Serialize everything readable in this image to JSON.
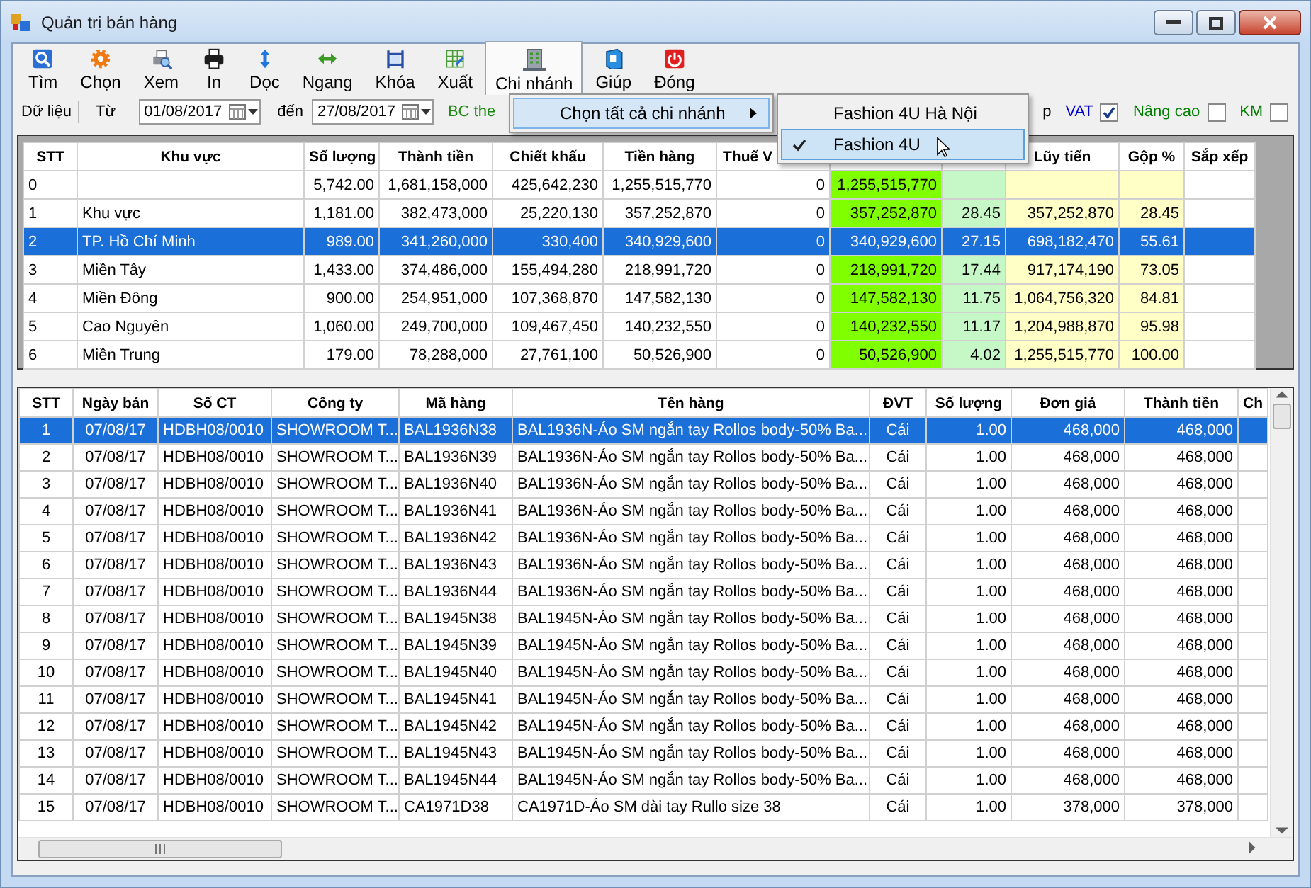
{
  "window": {
    "title": "Quản trị bán hàng"
  },
  "toolbar": [
    {
      "label": "Tìm",
      "selected": false
    },
    {
      "label": "Chọn",
      "selected": false
    },
    {
      "label": "Xem",
      "selected": false
    },
    {
      "label": "In",
      "selected": false
    },
    {
      "label": "Dọc",
      "selected": false
    },
    {
      "label": "Ngang",
      "selected": false
    },
    {
      "label": "Khóa",
      "selected": false
    },
    {
      "label": "Xuất",
      "selected": false
    },
    {
      "label": "Chi nhánh",
      "selected": true
    },
    {
      "label": "Giúp",
      "selected": false
    },
    {
      "label": "Đóng",
      "selected": false
    }
  ],
  "filter": {
    "data_label": "Dữ liệu",
    "from_label": "Từ",
    "from_date": "01/08/2017",
    "to_label": "đến",
    "to_date": "27/08/2017",
    "report_label": "BC the",
    "cut_button": "p",
    "options": [
      {
        "label": "VAT",
        "checked": true,
        "color": "#0000cc"
      },
      {
        "label": "Nâng cao",
        "checked": false,
        "color": "#008000"
      },
      {
        "label": "KM",
        "checked": false,
        "color": "#008000"
      }
    ]
  },
  "branch_menu": {
    "items": [
      {
        "label": "Chọn tất cả chi nhánh",
        "has_submenu": true
      }
    ],
    "submenu": [
      {
        "label": "Fashion 4U Hà Nội",
        "checked": false,
        "selected": false
      },
      {
        "label": "Fashion 4U",
        "checked": true,
        "selected": true
      }
    ]
  },
  "region_table": {
    "columns": [
      {
        "label": "STT"
      },
      {
        "label": "Khu vực"
      },
      {
        "label": "Số lượng"
      },
      {
        "label": "Thành tiền"
      },
      {
        "label": "Chiết khấu"
      },
      {
        "label": "Tiền hàng"
      },
      {
        "label": "Thuế V"
      },
      {
        "color": "#80ff00"
      },
      {
        "color": "#c6f7c6"
      },
      {
        "label": "Lũy tiến",
        "color": "#ffffc6"
      },
      {
        "label": "Gộp %",
        "color": "#ffffc6"
      },
      {
        "label": "Sắp xếp"
      }
    ],
    "rows": [
      {
        "selected": false,
        "cells": [
          "0",
          null,
          "5,742.00",
          "1,681,158,000",
          "425,642,230",
          "1,255,515,770",
          "0",
          "1,255,515,770",
          null,
          null,
          null,
          null
        ]
      },
      {
        "selected": false,
        "cells": [
          "1",
          "Khu vực",
          "1,181.00",
          "382,473,000",
          "25,220,130",
          "357,252,870",
          "0",
          "357,252,870",
          "28.45",
          "357,252,870",
          "28.45",
          null
        ]
      },
      {
        "selected": true,
        "cells": [
          "2",
          "TP. Hồ Chí Minh",
          "989.00",
          "341,260,000",
          "330,400",
          "340,929,600",
          "0",
          "340,929,600",
          "27.15",
          "698,182,470",
          "55.61",
          null
        ]
      },
      {
        "selected": false,
        "cells": [
          "3",
          "Miền Tây",
          "1,433.00",
          "374,486,000",
          "155,494,280",
          "218,991,720",
          "0",
          "218,991,720",
          "17.44",
          "917,174,190",
          "73.05",
          null
        ]
      },
      {
        "selected": false,
        "cells": [
          "4",
          "Miền Đông",
          "900.00",
          "254,951,000",
          "107,368,870",
          "147,582,130",
          "0",
          "147,582,130",
          "11.75",
          "1,064,756,320",
          "84.81",
          null
        ]
      },
      {
        "selected": false,
        "cells": [
          "5",
          "Cao Nguyên",
          "1,060.00",
          "249,700,000",
          "109,467,450",
          "140,232,550",
          "0",
          "140,232,550",
          "11.17",
          "1,204,988,870",
          "95.98",
          null
        ]
      },
      {
        "selected": false,
        "cells": [
          "6",
          "Miền Trung",
          "179.00",
          "78,288,000",
          "27,761,100",
          "50,526,900",
          "0",
          "50,526,900",
          "4.02",
          "1,255,515,770",
          "100.00",
          null
        ]
      }
    ]
  },
  "sales_table": {
    "columns": [
      "STT",
      "Ngày bán",
      "Số CT",
      "Công ty",
      "Mã hàng",
      "Tên hàng",
      "ĐVT",
      "Số lượng",
      "Đơn giá",
      "Thành tiền",
      "Ch"
    ],
    "rows": [
      {
        "selected": true,
        "cells": [
          "1",
          "07/08/17",
          "HDBH08/0010",
          "SHOWROOM T...",
          "BAL1936N38",
          "BAL1936N-Áo SM ngắn tay Rollos body-50% Ba...",
          "Cái",
          "1.00",
          "468,000",
          "468,000"
        ]
      },
      {
        "selected": false,
        "cells": [
          "2",
          "07/08/17",
          "HDBH08/0010",
          "SHOWROOM T...",
          "BAL1936N39",
          "BAL1936N-Áo SM ngắn tay Rollos body-50% Ba...",
          "Cái",
          "1.00",
          "468,000",
          "468,000"
        ]
      },
      {
        "selected": false,
        "cells": [
          "3",
          "07/08/17",
          "HDBH08/0010",
          "SHOWROOM T...",
          "BAL1936N40",
          "BAL1936N-Áo SM ngắn tay Rollos body-50% Ba...",
          "Cái",
          "1.00",
          "468,000",
          "468,000"
        ]
      },
      {
        "selected": false,
        "cells": [
          "4",
          "07/08/17",
          "HDBH08/0010",
          "SHOWROOM T...",
          "BAL1936N41",
          "BAL1936N-Áo SM ngắn tay Rollos body-50% Ba...",
          "Cái",
          "1.00",
          "468,000",
          "468,000"
        ]
      },
      {
        "selected": false,
        "cells": [
          "5",
          "07/08/17",
          "HDBH08/0010",
          "SHOWROOM T...",
          "BAL1936N42",
          "BAL1936N-Áo SM ngắn tay Rollos body-50% Ba...",
          "Cái",
          "1.00",
          "468,000",
          "468,000"
        ]
      },
      {
        "selected": false,
        "cells": [
          "6",
          "07/08/17",
          "HDBH08/0010",
          "SHOWROOM T...",
          "BAL1936N43",
          "BAL1936N-Áo SM ngắn tay Rollos body-50% Ba...",
          "Cái",
          "1.00",
          "468,000",
          "468,000"
        ]
      },
      {
        "selected": false,
        "cells": [
          "7",
          "07/08/17",
          "HDBH08/0010",
          "SHOWROOM T...",
          "BAL1936N44",
          "BAL1936N-Áo SM ngắn tay Rollos body-50% Ba...",
          "Cái",
          "1.00",
          "468,000",
          "468,000"
        ]
      },
      {
        "selected": false,
        "cells": [
          "8",
          "07/08/17",
          "HDBH08/0010",
          "SHOWROOM T...",
          "BAL1945N38",
          "BAL1945N-Áo SM ngắn tay Rollos body-50% Ba...",
          "Cái",
          "1.00",
          "468,000",
          "468,000"
        ]
      },
      {
        "selected": false,
        "cells": [
          "9",
          "07/08/17",
          "HDBH08/0010",
          "SHOWROOM T...",
          "BAL1945N39",
          "BAL1945N-Áo SM ngắn tay Rollos body-50% Ba...",
          "Cái",
          "1.00",
          "468,000",
          "468,000"
        ]
      },
      {
        "selected": false,
        "cells": [
          "10",
          "07/08/17",
          "HDBH08/0010",
          "SHOWROOM T...",
          "BAL1945N40",
          "BAL1945N-Áo SM ngắn tay Rollos body-50% Ba...",
          "Cái",
          "1.00",
          "468,000",
          "468,000"
        ]
      },
      {
        "selected": false,
        "cells": [
          "11",
          "07/08/17",
          "HDBH08/0010",
          "SHOWROOM T...",
          "BAL1945N41",
          "BAL1945N-Áo SM ngắn tay Rollos body-50% Ba...",
          "Cái",
          "1.00",
          "468,000",
          "468,000"
        ]
      },
      {
        "selected": false,
        "cells": [
          "12",
          "07/08/17",
          "HDBH08/0010",
          "SHOWROOM T...",
          "BAL1945N42",
          "BAL1945N-Áo SM ngắn tay Rollos body-50% Ba...",
          "Cái",
          "1.00",
          "468,000",
          "468,000"
        ]
      },
      {
        "selected": false,
        "cells": [
          "13",
          "07/08/17",
          "HDBH08/0010",
          "SHOWROOM T...",
          "BAL1945N43",
          "BAL1945N-Áo SM ngắn tay Rollos body-50% Ba...",
          "Cái",
          "1.00",
          "468,000",
          "468,000"
        ]
      },
      {
        "selected": false,
        "cells": [
          "14",
          "07/08/17",
          "HDBH08/0010",
          "SHOWROOM T...",
          "BAL1945N44",
          "BAL1945N-Áo SM ngắn tay Rollos body-50% Ba...",
          "Cái",
          "1.00",
          "468,000",
          "468,000"
        ]
      },
      {
        "selected": false,
        "cells": [
          "15",
          "07/08/17",
          "HDBH08/0010",
          "SHOWROOM T...",
          "CA1971D38",
          "CA1971D-Áo SM dài tay Rullo size 38",
          "Cái",
          "1.00",
          "378,000",
          "378,000"
        ]
      }
    ]
  }
}
